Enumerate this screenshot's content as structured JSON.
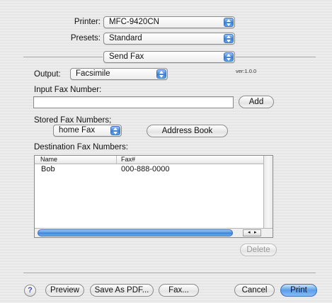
{
  "header": {
    "printer_label": "Printer:",
    "printer_value": "MFC-9420CN",
    "presets_label": "Presets:",
    "presets_value": "Standard",
    "panel_value": "Send Fax"
  },
  "fax": {
    "output_label": "Output:",
    "output_value": "Facsimile",
    "version": "ver:1.0.0",
    "input_label": "Input Fax Number:",
    "input_value": "",
    "add_label": "Add",
    "stored_label": "Stored Fax Numbers;",
    "stored_value": "home Fax",
    "address_book_label": "Address Book",
    "destination_label": "Destination Fax Numbers:",
    "columns": [
      "Name",
      "Fax#"
    ],
    "rows": [
      {
        "name": "Bob",
        "fax": "000-888-0000"
      }
    ],
    "delete_label": "Delete",
    "scroll_left": "◂",
    "scroll_right": "▸"
  },
  "footer": {
    "help_label": "?",
    "preview_label": "Preview",
    "save_pdf_label": "Save As PDF...",
    "fax_label": "Fax...",
    "cancel_label": "Cancel",
    "print_label": "Print"
  }
}
